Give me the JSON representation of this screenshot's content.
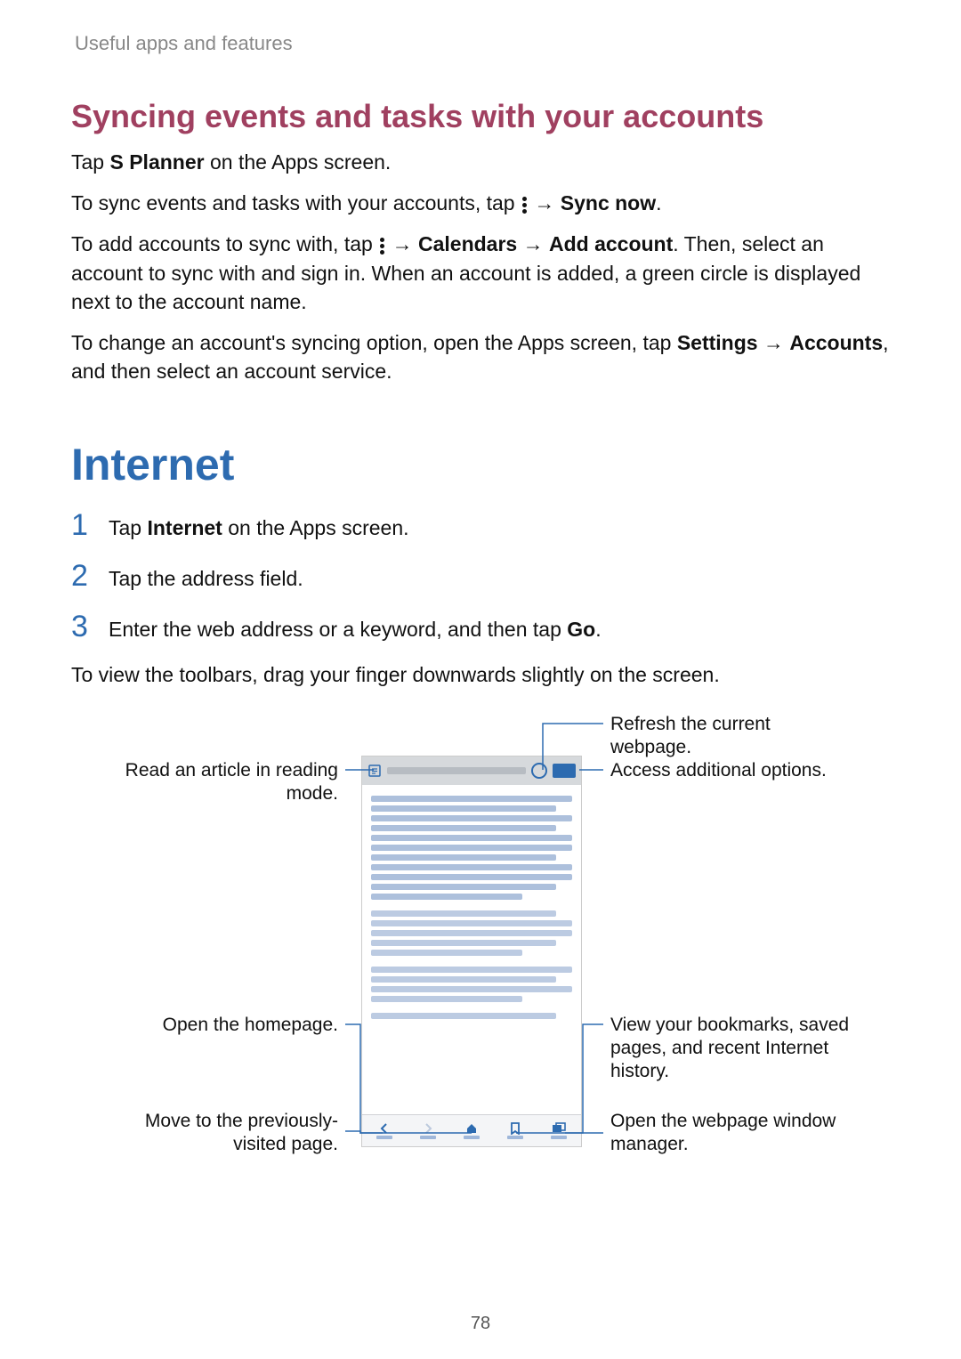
{
  "breadcrumb": "Useful apps and features",
  "subsection_title": "Syncing events and tasks with your accounts",
  "para_tap_splanner": {
    "pre": "Tap ",
    "bold": "S Planner",
    "post": " on the Apps screen."
  },
  "para_sync_now": {
    "pre": "To sync events and tasks with your accounts, tap ",
    "arrow": " → ",
    "bold": "Sync now",
    "end": "."
  },
  "para_add_account": {
    "pre": "To add accounts to sync with, tap ",
    "arrow1": " → ",
    "bold1": "Calendars",
    "arrow2": " → ",
    "bold2": "Add account",
    "post": ". Then, select an account to sync with and sign in. When an account is added, a green circle is displayed next to the account name."
  },
  "para_change_sync": {
    "pre": "To change an account's syncing option, open the Apps screen, tap ",
    "bold1": "Settings",
    "arrow": " → ",
    "bold2": "Accounts",
    "post": ", and then select an account service."
  },
  "section_title": "Internet",
  "step1": {
    "num": "1",
    "pre": "Tap ",
    "bold": "Internet",
    "post": " on the Apps screen."
  },
  "step2": {
    "num": "2",
    "text": "Tap the address field."
  },
  "step3": {
    "num": "3",
    "pre": "Enter the web address or a keyword, and then tap ",
    "bold": "Go",
    "post": "."
  },
  "para_toolbars": "To view the toolbars, drag your finger downwards slightly on the screen.",
  "callouts": {
    "refresh": "Refresh the current webpage.",
    "reading_mode": "Read an article in reading mode.",
    "additional_options": "Access additional options.",
    "homepage": "Open the homepage.",
    "bookmarks": "View your bookmarks, saved pages, and recent Internet history.",
    "back": "Move to the previously-visited page.",
    "window_manager": "Open the webpage window manager."
  },
  "page_number": "78"
}
